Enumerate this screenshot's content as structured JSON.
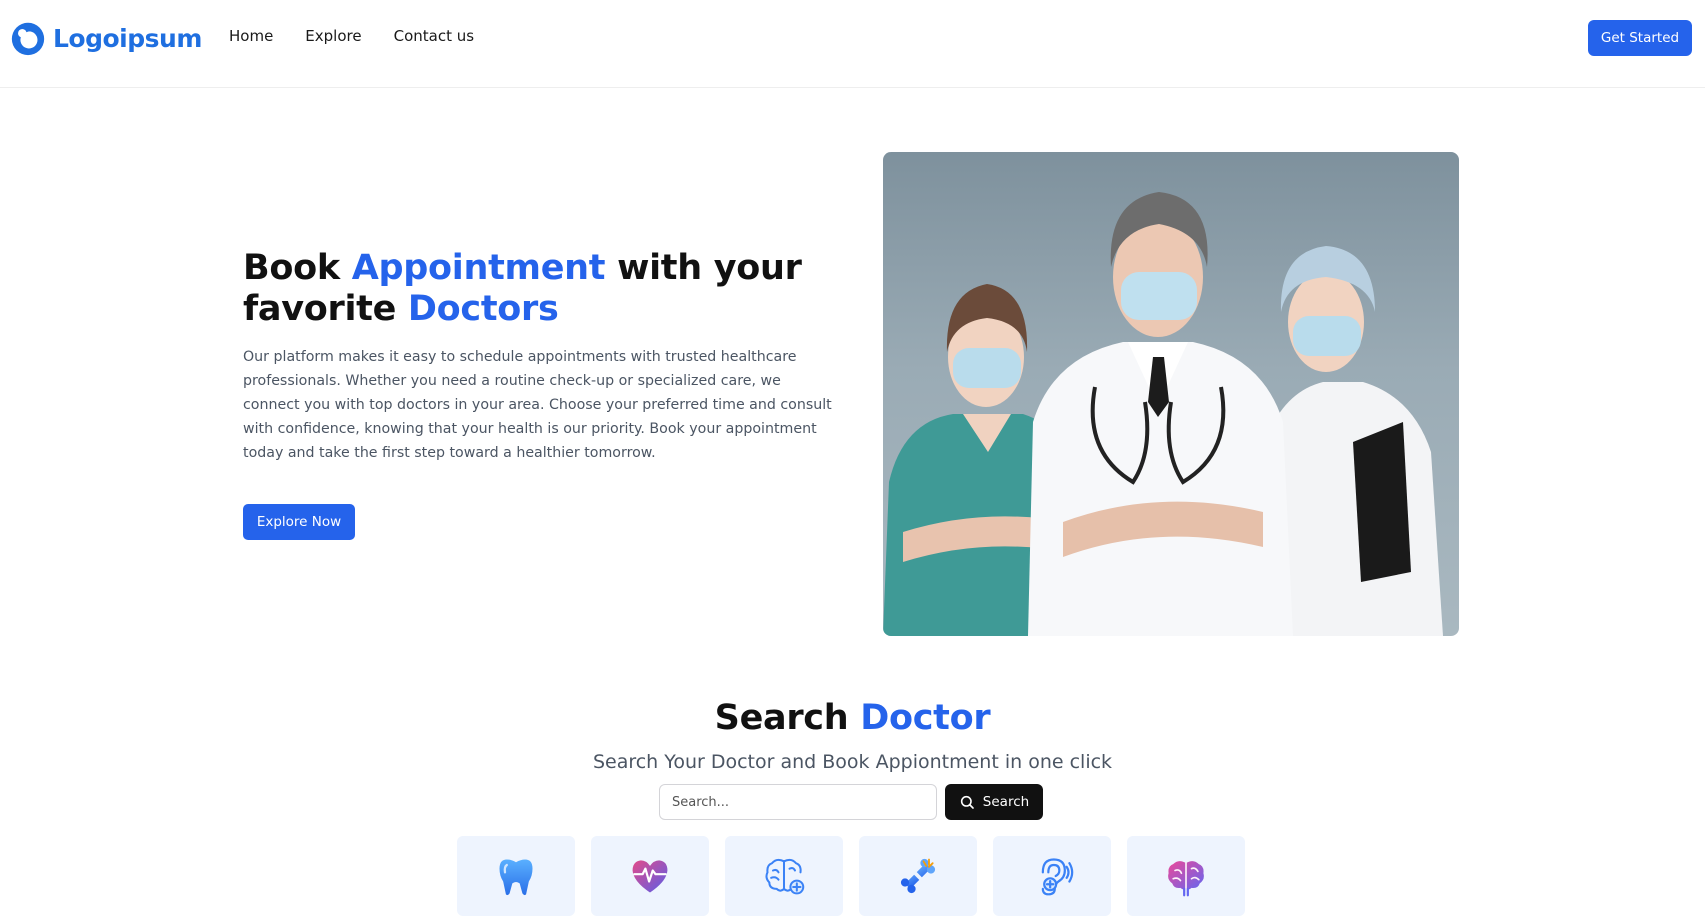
{
  "header": {
    "logo_text": "Logoipsum",
    "nav": [
      {
        "label": "Home"
      },
      {
        "label": "Explore"
      },
      {
        "label": "Contact us"
      }
    ],
    "cta_label": "Get Started"
  },
  "hero": {
    "title_part1": "Book ",
    "title_accent1": "Appointment",
    "title_part2": " with your favorite ",
    "title_accent2": "Doctors",
    "description": "Our platform makes it easy to schedule appointments with trusted healthcare professionals. Whether you need a routine check-up or specialized care, we connect you with top doctors in your area. Choose your preferred time and consult with confidence, knowing that your health is our priority. Book your appointment today and take the first step toward a healthier tomorrow.",
    "button_label": "Explore Now"
  },
  "search": {
    "title_part1": "Search ",
    "title_accent": "Doctor",
    "subtitle": "Search Your Doctor and Book Appiontment in one click",
    "placeholder": "Search...",
    "button_label": "Search",
    "categories": [
      {
        "icon": "tooth-icon"
      },
      {
        "icon": "heartbeat-icon"
      },
      {
        "icon": "brain-plus-icon"
      },
      {
        "icon": "bone-icon"
      },
      {
        "icon": "ear-icon"
      },
      {
        "icon": "brain-icon"
      }
    ]
  },
  "colors": {
    "accent": "#2563eb",
    "text": "#111111",
    "muted": "#4b5563",
    "category_bg": "#eef4fe"
  }
}
